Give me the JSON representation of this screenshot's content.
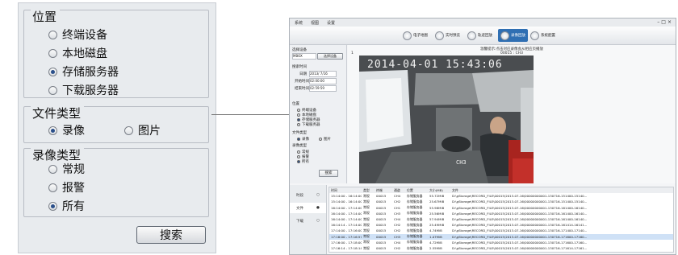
{
  "zoom_panel": {
    "location": {
      "title": "位置",
      "options": [
        {
          "label": "终端设备",
          "selected": false
        },
        {
          "label": "本地磁盘",
          "selected": false
        },
        {
          "label": "存储服务器",
          "selected": true
        },
        {
          "label": "下载服务器",
          "selected": false
        }
      ]
    },
    "file_type": {
      "title": "文件类型",
      "options": [
        {
          "label": "录像",
          "selected": true
        },
        {
          "label": "图片",
          "selected": false
        }
      ]
    },
    "record_type": {
      "title": "录像类型",
      "options": [
        {
          "label": "常规",
          "selected": false
        },
        {
          "label": "报警",
          "selected": false
        },
        {
          "label": "所有",
          "selected": true
        }
      ]
    },
    "search_button": "搜索"
  },
  "app": {
    "menu": [
      "系统",
      "视图",
      "设置"
    ],
    "toolbar": [
      {
        "label": "电子地图",
        "active": false
      },
      {
        "label": "实时预览",
        "active": false
      },
      {
        "label": "轨迹回放",
        "active": false
      },
      {
        "label": "录像回放",
        "active": true
      },
      {
        "label": "系统配置",
        "active": false
      }
    ],
    "side": {
      "select_device": "选择设备",
      "device_value": "MBOX",
      "choose_btn": "选择设备",
      "search_time": "搜索时间",
      "date_label": "日期",
      "date_value": "2013/ 7/16",
      "start_label": "开始时间",
      "start_value": "02:00:00",
      "end_label": "结束时间",
      "end_value": "02:59:59",
      "location_label": "位置",
      "location_opts": [
        "终端设备",
        "本地磁盘",
        "存储服务器",
        "下载服务器"
      ],
      "file_type_label": "文件类型",
      "file_type_opts": [
        "录像",
        "图片"
      ],
      "rec_type_label": "录像类型",
      "rec_type_opts": [
        "常规",
        "报警",
        "所有"
      ],
      "search_btn": "搜索"
    },
    "video": {
      "title": "温馨提示:点击对应录像会从相应页播放",
      "info": "00015 : CH3",
      "channel_no": "1",
      "osd_time": "2014-04-01  15:43:06",
      "osd_channel": "CH3",
      "time_start": "17:16:00",
      "time_end": "17:16:57",
      "current_time": "17:18:51"
    },
    "tabs": [
      "时段",
      "文件",
      "下载"
    ],
    "table": {
      "headers": [
        "时间",
        "类型",
        "终端",
        "通道",
        "位置",
        "大小(MB)",
        "文件"
      ],
      "rows": [
        [
          "15:14:00 - 16:14:00",
          "常规",
          "00015",
          "CH4",
          "存储服务器",
          "55.72MiB",
          "D:\\gStorage\\RECORD_FILE\\00015\\2013-07-16\\00000000001-130716-151400-15140..."
        ],
        [
          "15:14:00 - 16:14:00",
          "常规",
          "00015",
          "CH2",
          "存储服务器",
          "25.67MiB",
          "D:\\gStorage\\RECORD_FILE\\00015\\2013-07-16\\00000000001-130716-151400-15140..."
        ],
        [
          "16:14:00 - 17:14:00",
          "常规",
          "00015",
          "CH1",
          "存储服务器",
          "55.98MiB",
          "D:\\gStorage\\RECORD_FILE\\00015\\2013-07-16\\00000000001-130716-161400-16140..."
        ],
        [
          "16:14:00 - 17:14:00",
          "常规",
          "00015",
          "CH3",
          "存储服务器",
          "25.56MiB",
          "D:\\gStorage\\RECORD_FILE\\00015\\2013-07-16\\00000000001-130716-161400-16140..."
        ],
        [
          "16:14:00 - 17:14:00",
          "常规",
          "00015",
          "CH4",
          "存储服务器",
          "57.94MiB",
          "D:\\gStorage\\RECORD_FILE\\00015\\2013-07-16\\00000000001-130716-161400-16140..."
        ],
        [
          "16:14:14 - 17:14:00",
          "常规",
          "00015",
          "CH2",
          "存储服务器",
          "25.49MiB",
          "D:\\gStorage\\RECORD_FILE\\00015\\2013-07-16\\00000000001-130716-161414-16141..."
        ],
        [
          "17:14:00 - 17:16:00",
          "常规",
          "00015",
          "CH2",
          "存储服务器",
          "4.74MiB",
          "D:\\gStorage\\RECORD_FILE\\00015\\2013-07-16\\00000000001-130716-171400-17140..."
        ],
        [
          "17:16:00 - 17:16:57",
          "常规",
          "00015",
          "CH3",
          "存储服务器",
          "1.07MiB",
          "D:\\gStorage\\RECORD_FILE\\00015\\2013-07-16\\00000000001-130716-171600-17160..."
        ],
        [
          "17:16:00 - 17:18:00",
          "常规",
          "00015",
          "CH4",
          "存储服务器",
          "4.72MiB",
          "D:\\gStorage\\RECORD_FILE\\00015\\2013-07-16\\00000000001-130716-171600-17160..."
        ],
        [
          "17:16:14 - 17:18:14",
          "常规",
          "00015",
          "CH2",
          "存储服务器",
          "2.55MiB",
          "D:\\gStorage\\RECORD_FILE\\00015\\2013-07-16\\00000000001-130716-171614-17161..."
        ]
      ],
      "selected_index": 7
    }
  }
}
